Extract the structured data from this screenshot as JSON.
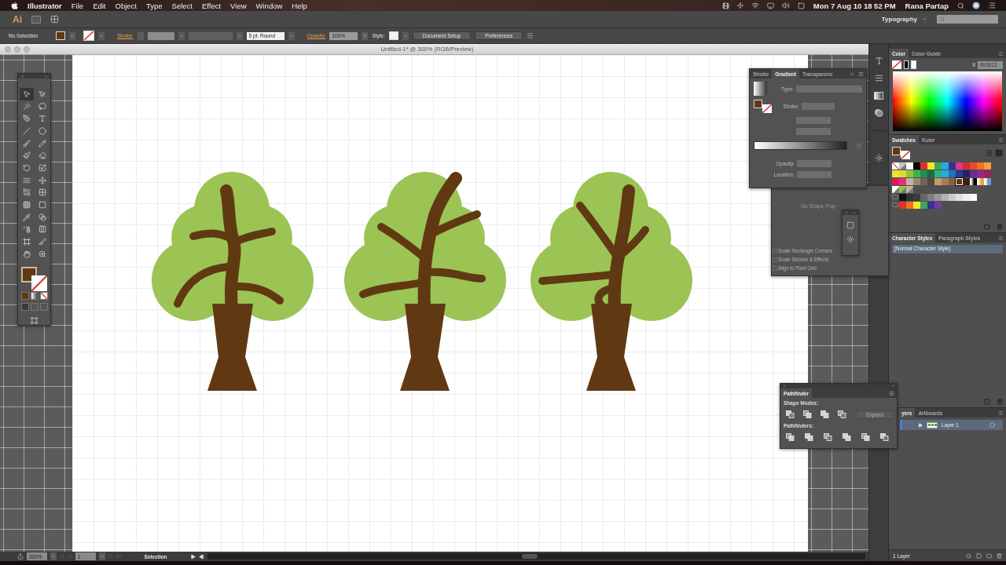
{
  "menubar": {
    "app": "Illustrator",
    "menus": [
      "File",
      "Edit",
      "Object",
      "Type",
      "Select",
      "Effect",
      "View",
      "Window",
      "Help"
    ],
    "clock": "Mon 7 Aug  10 18 52 PM",
    "user": "Rana Partap"
  },
  "appbar": {
    "logo": "Ai",
    "workspace": "Typography"
  },
  "control_bar": {
    "selection": "No Selection",
    "stroke_label": "Stroke:",
    "brush": "5 pt. Round",
    "opacity_label": "Opacity:",
    "opacity": "100%",
    "style_label": "Style:",
    "buttons": [
      "Document Setup",
      "Preferences"
    ]
  },
  "document": {
    "title": "Untitled-1* @ 300% (RGB/Preview)",
    "objects": [
      {
        "kind": "tree"
      },
      {
        "kind": "tree"
      },
      {
        "kind": "tree"
      }
    ]
  },
  "tools": [
    {
      "selected": true
    },
    {
      "selected": false
    },
    {
      "selected": false
    },
    {
      "selected": false
    },
    {
      "selected": false
    },
    {
      "selected": false
    },
    {
      "selected": false
    },
    {
      "selected": false
    },
    {
      "selected": false
    },
    {
      "selected": false
    },
    {
      "selected": false
    },
    {
      "selected": false
    },
    {
      "selected": false
    },
    {
      "selected": false
    },
    {
      "selected": false
    },
    {
      "selected": false
    },
    {
      "selected": false
    },
    {
      "selected": false
    },
    {
      "selected": false
    },
    {
      "selected": false
    },
    {
      "selected": false
    },
    {
      "selected": false
    },
    {
      "selected": false
    },
    {
      "selected": false
    },
    {
      "selected": false
    },
    {
      "selected": false
    },
    {
      "selected": false
    },
    {
      "selected": false
    }
  ],
  "gradient_panel": {
    "tabs": [
      {
        "label": "Stroke",
        "selected": false
      },
      {
        "label": "Gradient",
        "selected": true
      },
      {
        "label": "Transparenc",
        "selected": false
      }
    ],
    "type_label": "Type:",
    "stroke_label": "Stroke:",
    "opacity_label": "Opacity:",
    "location_label": "Location:"
  },
  "shape_panel": {
    "message": "No Shape Prop",
    "options": [
      {
        "label": "Scale Rectangle Corners",
        "checked": false
      },
      {
        "label": "Scale Strokes & Effects",
        "checked": false
      },
      {
        "label": "Align to Pixel Grid",
        "checked": false
      }
    ]
  },
  "color_panel": {
    "tabs": [
      {
        "label": "Color",
        "selected": true
      },
      {
        "label": "Color Guide",
        "selected": false
      }
    ],
    "hex_label": "#",
    "hex": "603913"
  },
  "swatches_panel": {
    "tabs": [
      {
        "label": "Swatches",
        "selected": true
      },
      {
        "label": "Kuler",
        "selected": false
      }
    ],
    "groups": [
      {
        "folder": false,
        "swatches": [
          {
            "kind": "none",
            "color": "#ffffff",
            "selected": false
          },
          {
            "kind": "pattern",
            "color": "#b8c8c8",
            "selected": false
          },
          {
            "kind": "solid",
            "color": "#ffffff",
            "selected": false
          },
          {
            "kind": "solid",
            "color": "#000000",
            "selected": false
          },
          {
            "kind": "solid",
            "color": "#e0302a",
            "selected": false
          },
          {
            "kind": "solid",
            "color": "#f5e82a",
            "selected": false
          },
          {
            "kind": "solid",
            "color": "#3aa858",
            "selected": false
          },
          {
            "kind": "solid",
            "color": "#2aa8e0",
            "selected": false
          },
          {
            "kind": "solid",
            "color": "#2e3592",
            "selected": false
          },
          {
            "kind": "solid",
            "color": "#e0358c",
            "selected": false
          },
          {
            "kind": "solid",
            "color": "#d52a30",
            "selected": false
          },
          {
            "kind": "solid",
            "color": "#e84a2a",
            "selected": false
          },
          {
            "kind": "solid",
            "color": "#f07028",
            "selected": false
          },
          {
            "kind": "solid",
            "color": "#f2a13a",
            "selected": false
          }
        ]
      },
      {
        "folder": false,
        "swatches": [
          {
            "kind": "solid",
            "color": "#f4e030",
            "selected": false
          },
          {
            "kind": "solid",
            "color": "#d8dc30",
            "selected": false
          },
          {
            "kind": "solid",
            "color": "#8dc63f",
            "selected": false
          },
          {
            "kind": "solid",
            "color": "#3ab54a",
            "selected": false
          },
          {
            "kind": "solid",
            "color": "#159450",
            "selected": false
          },
          {
            "kind": "solid",
            "color": "#1e6a3a",
            "selected": false
          },
          {
            "kind": "solid",
            "color": "#2bb680",
            "selected": false
          },
          {
            "kind": "solid",
            "color": "#27aae1",
            "selected": false
          },
          {
            "kind": "solid",
            "color": "#1c75bc",
            "selected": false
          },
          {
            "kind": "solid",
            "color": "#2b3990",
            "selected": false
          },
          {
            "kind": "solid",
            "color": "#262262",
            "selected": false
          },
          {
            "kind": "solid",
            "color": "#662d91",
            "selected": false
          },
          {
            "kind": "solid",
            "color": "#92278f",
            "selected": false
          },
          {
            "kind": "solid",
            "color": "#9e1f63",
            "selected": false
          }
        ]
      },
      {
        "folder": false,
        "swatches": [
          {
            "kind": "solid",
            "color": "#da1c5c",
            "selected": false
          },
          {
            "kind": "solid",
            "color": "#ee2a7b",
            "selected": false
          },
          {
            "kind": "solid",
            "color": "#c2b59b",
            "selected": false
          },
          {
            "kind": "solid",
            "color": "#998675",
            "selected": false
          },
          {
            "kind": "solid",
            "color": "#736357",
            "selected": false
          },
          {
            "kind": "solid",
            "color": "#534741",
            "selected": false
          },
          {
            "kind": "solid",
            "color": "#c69c6d",
            "selected": false
          },
          {
            "kind": "solid",
            "color": "#a67c52",
            "selected": false
          },
          {
            "kind": "solid",
            "color": "#8c6239",
            "selected": false
          },
          {
            "kind": "solid",
            "color": "#603913",
            "selected": true
          },
          {
            "kind": "solid",
            "color": "#42210b",
            "selected": false
          },
          {
            "kind": "gradient",
            "color": "#000000",
            "selected": false
          },
          {
            "kind": "gradient",
            "color": "#f2a13a",
            "selected": false
          },
          {
            "kind": "gradient",
            "color": "#6a9ad0",
            "selected": false
          }
        ]
      },
      {
        "folder": false,
        "swatches": [
          {
            "kind": "pattern",
            "color": "#ffffff",
            "selected": false
          },
          {
            "kind": "pattern",
            "color": "#8dc63f",
            "selected": false
          },
          {
            "kind": "pattern",
            "color": "#c2b59b",
            "selected": false
          }
        ]
      },
      {
        "folder": true,
        "swatches": [
          {
            "kind": "solid",
            "color": "#111111",
            "selected": false
          },
          {
            "kind": "solid",
            "color": "#333333",
            "selected": false
          },
          {
            "kind": "solid",
            "color": "#3d3d3d",
            "selected": false
          },
          {
            "kind": "solid",
            "color": "#666666",
            "selected": false
          },
          {
            "kind": "solid",
            "color": "#808080",
            "selected": false
          },
          {
            "kind": "solid",
            "color": "#999999",
            "selected": false
          },
          {
            "kind": "solid",
            "color": "#b3b3b3",
            "selected": false
          },
          {
            "kind": "solid",
            "color": "#cccccc",
            "selected": false
          },
          {
            "kind": "solid",
            "color": "#e0e0e0",
            "selected": false
          },
          {
            "kind": "solid",
            "color": "#f0f0f0",
            "selected": false
          },
          {
            "kind": "solid",
            "color": "#fafafa",
            "selected": false
          }
        ]
      },
      {
        "folder": true,
        "swatches": [
          {
            "kind": "solid",
            "color": "#e0302a",
            "selected": false
          },
          {
            "kind": "solid",
            "color": "#f07028",
            "selected": false
          },
          {
            "kind": "solid",
            "color": "#f5e82a",
            "selected": false
          },
          {
            "kind": "solid",
            "color": "#3aa858",
            "selected": false
          },
          {
            "kind": "solid",
            "color": "#2e3592",
            "selected": false
          },
          {
            "kind": "solid",
            "color": "#7a3a9a",
            "selected": false
          }
        ]
      }
    ]
  },
  "styles_panel": {
    "tabs": [
      {
        "label": "Character Styles",
        "selected": true
      },
      {
        "label": "Paragraph Styles",
        "selected": false
      }
    ],
    "items": [
      {
        "label": "[Normal Character Style]",
        "selected": true
      }
    ]
  },
  "pathfinder": {
    "title": "Pathfinder",
    "shape_modes_label": "Shape Modes:",
    "expand": "Expand",
    "pathfinders_label": "Pathfinders:"
  },
  "layers_panel": {
    "tabs": [
      {
        "label": "yers",
        "selected": true
      },
      {
        "label": "Artboards",
        "selected": false
      }
    ],
    "layers": [
      {
        "name": "Layer 1",
        "expanded": false,
        "selected": true
      }
    ],
    "count": "1 Layer"
  },
  "status_bar": {
    "zoom": "300%",
    "artboard": "1",
    "tool": "Selection"
  }
}
